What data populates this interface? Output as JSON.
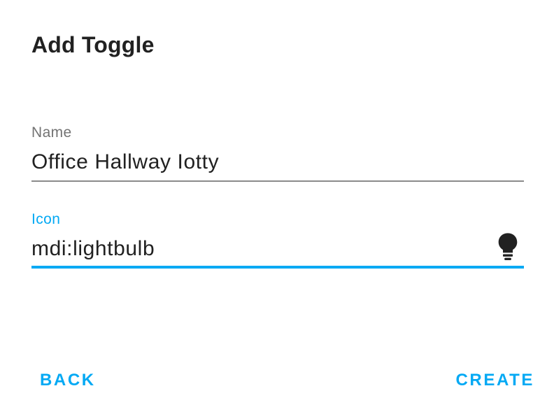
{
  "dialog": {
    "title": "Add Toggle",
    "fields": {
      "name": {
        "label": "Name",
        "value": "Office Hallway Iotty"
      },
      "icon": {
        "label": "Icon",
        "value": "mdi:lightbulb",
        "preview_icon": "lightbulb-icon",
        "focused": true
      }
    },
    "actions": {
      "back_label": "BACK",
      "create_label": "CREATE"
    }
  },
  "colors": {
    "accent": "#03a9f4",
    "text_primary": "#212121",
    "text_secondary": "#737373",
    "underline_inactive": "#8a8a8a"
  }
}
